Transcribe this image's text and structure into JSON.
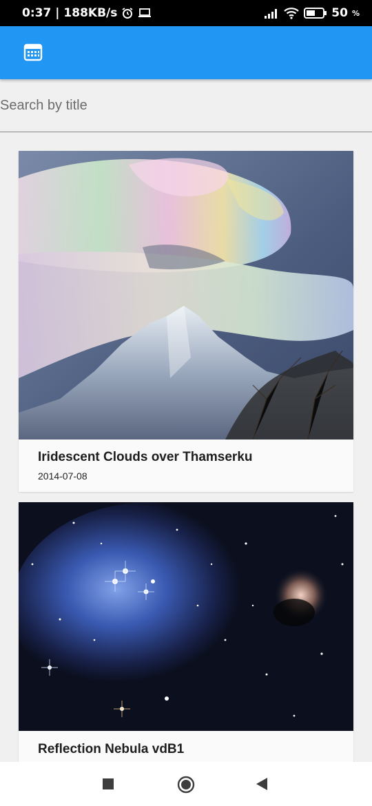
{
  "status_bar": {
    "time": "0:37",
    "network_speed": "| 188KB/s",
    "battery": "50",
    "battery_unit": "%",
    "icons": [
      "alarm-icon",
      "laptop-icon",
      "signal-icon",
      "wifi-icon",
      "battery-icon"
    ]
  },
  "app_bar": {
    "icon": "calendar-icon",
    "accent_color": "#2196f3"
  },
  "search": {
    "placeholder": "Search by title"
  },
  "cards": [
    {
      "title": "Iridescent Clouds over Thamserku",
      "date": "2014-07-08",
      "image": "iridescent-clouds-mountain-photo"
    },
    {
      "title": "Reflection Nebula vdB1",
      "date": "",
      "image": "reflection-nebula-star-field-photo"
    }
  ],
  "nav_bar": {
    "buttons": [
      "recent-apps-icon",
      "home-icon",
      "back-icon"
    ]
  }
}
